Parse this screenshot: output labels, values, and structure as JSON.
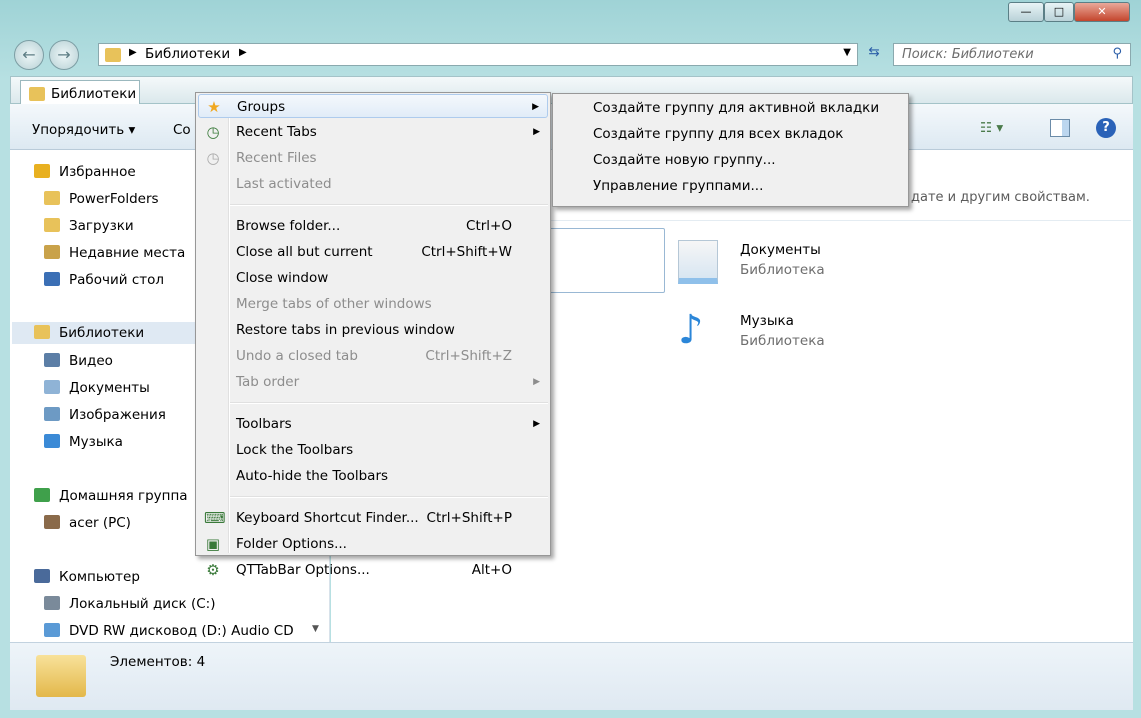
{
  "window": {
    "minimize": "—",
    "maximize": "□",
    "close": "✕"
  },
  "nav": {
    "back_icon": "arrow-left",
    "forward_icon": "arrow-right"
  },
  "address": {
    "crumb": "Библиотеки"
  },
  "search": {
    "placeholder": "Поиск: Библиотеки"
  },
  "tab": {
    "label": "Библиотеки"
  },
  "command_bar": {
    "organize": "Упорядочить ▾",
    "create": "Со"
  },
  "sidebar": {
    "items": [
      {
        "label": "Избранное",
        "icon": "star",
        "color": "#e8b020"
      },
      {
        "label": "PowerFolders",
        "icon": "folder",
        "color": "#e8c25a"
      },
      {
        "label": "Загрузки",
        "icon": "folder-download",
        "color": "#e8c25a"
      },
      {
        "label": "Недавние места",
        "icon": "recent-places",
        "color": "#c9a24a"
      },
      {
        "label": "Рабочий стол",
        "icon": "desktop",
        "color": "#3b6fb5"
      },
      {
        "label": "Библиотеки",
        "icon": "libraries",
        "color": "#e8c25a"
      },
      {
        "label": "Видео",
        "icon": "video",
        "color": "#5c7ea6"
      },
      {
        "label": "Документы",
        "icon": "documents",
        "color": "#8fb3d6"
      },
      {
        "label": "Изображения",
        "icon": "images",
        "color": "#6d9ac4"
      },
      {
        "label": "Музыка",
        "icon": "music",
        "color": "#3b8ad6"
      },
      {
        "label": "Домашняя группа",
        "icon": "homegroup",
        "color": "#3fa04b"
      },
      {
        "label": "acer (PC)",
        "icon": "user",
        "color": "#8a6a4a"
      },
      {
        "label": "Компьютер",
        "icon": "computer",
        "color": "#4a6a9a"
      },
      {
        "label": "Локальный диск (C:)",
        "icon": "drive",
        "color": "#7a8a9a"
      },
      {
        "label": "DVD RW дисковод (D:) Audio CD",
        "icon": "dvd",
        "color": "#5a9ad6"
      }
    ]
  },
  "content": {
    "hint": "дате и другим свойствам.",
    "libraries": [
      {
        "name": "Документы",
        "type": "Библиотека"
      },
      {
        "name": "Музыка",
        "type": "Библиотека"
      }
    ]
  },
  "status": {
    "text": "Элементов: 4"
  },
  "menu": {
    "items": [
      {
        "label": "Groups",
        "icon": "★",
        "submenu": true,
        "highlighted": true
      },
      {
        "label": "Recent Tabs",
        "icon": "◷",
        "submenu": true
      },
      {
        "label": "Recent Files",
        "icon": "◷",
        "disabled": true
      },
      {
        "label": "Last activated",
        "disabled": true
      },
      {
        "separator": true
      },
      {
        "label": "Browse folder...",
        "shortcut": "Ctrl+O"
      },
      {
        "label": "Close all but current",
        "shortcut": "Ctrl+Shift+W"
      },
      {
        "label": "Close window"
      },
      {
        "label": "Merge tabs of other windows",
        "disabled": true
      },
      {
        "label": "Restore tabs in previous window"
      },
      {
        "label": "Undo a closed tab",
        "shortcut": "Ctrl+Shift+Z",
        "disabled": true
      },
      {
        "label": "Tab order",
        "submenu": true,
        "disabled": true
      },
      {
        "separator": true
      },
      {
        "label": "Toolbars",
        "submenu": true
      },
      {
        "label": "Lock the Toolbars"
      },
      {
        "label": "Auto-hide the Toolbars"
      },
      {
        "separator": true
      },
      {
        "label": "Keyboard Shortcut Finder...",
        "shortcut": "Ctrl+Shift+P",
        "icon": "⌨"
      },
      {
        "label": "Folder Options...",
        "icon": "▣"
      },
      {
        "label": "QTTabBar Options...",
        "shortcut": "Alt+O",
        "icon": "⚙"
      }
    ]
  },
  "submenu": {
    "items": [
      "Создайте группу для активной вкладки",
      "Создайте группу для всех вкладок",
      "Создайте новую группу...",
      "Управление группами..."
    ]
  }
}
